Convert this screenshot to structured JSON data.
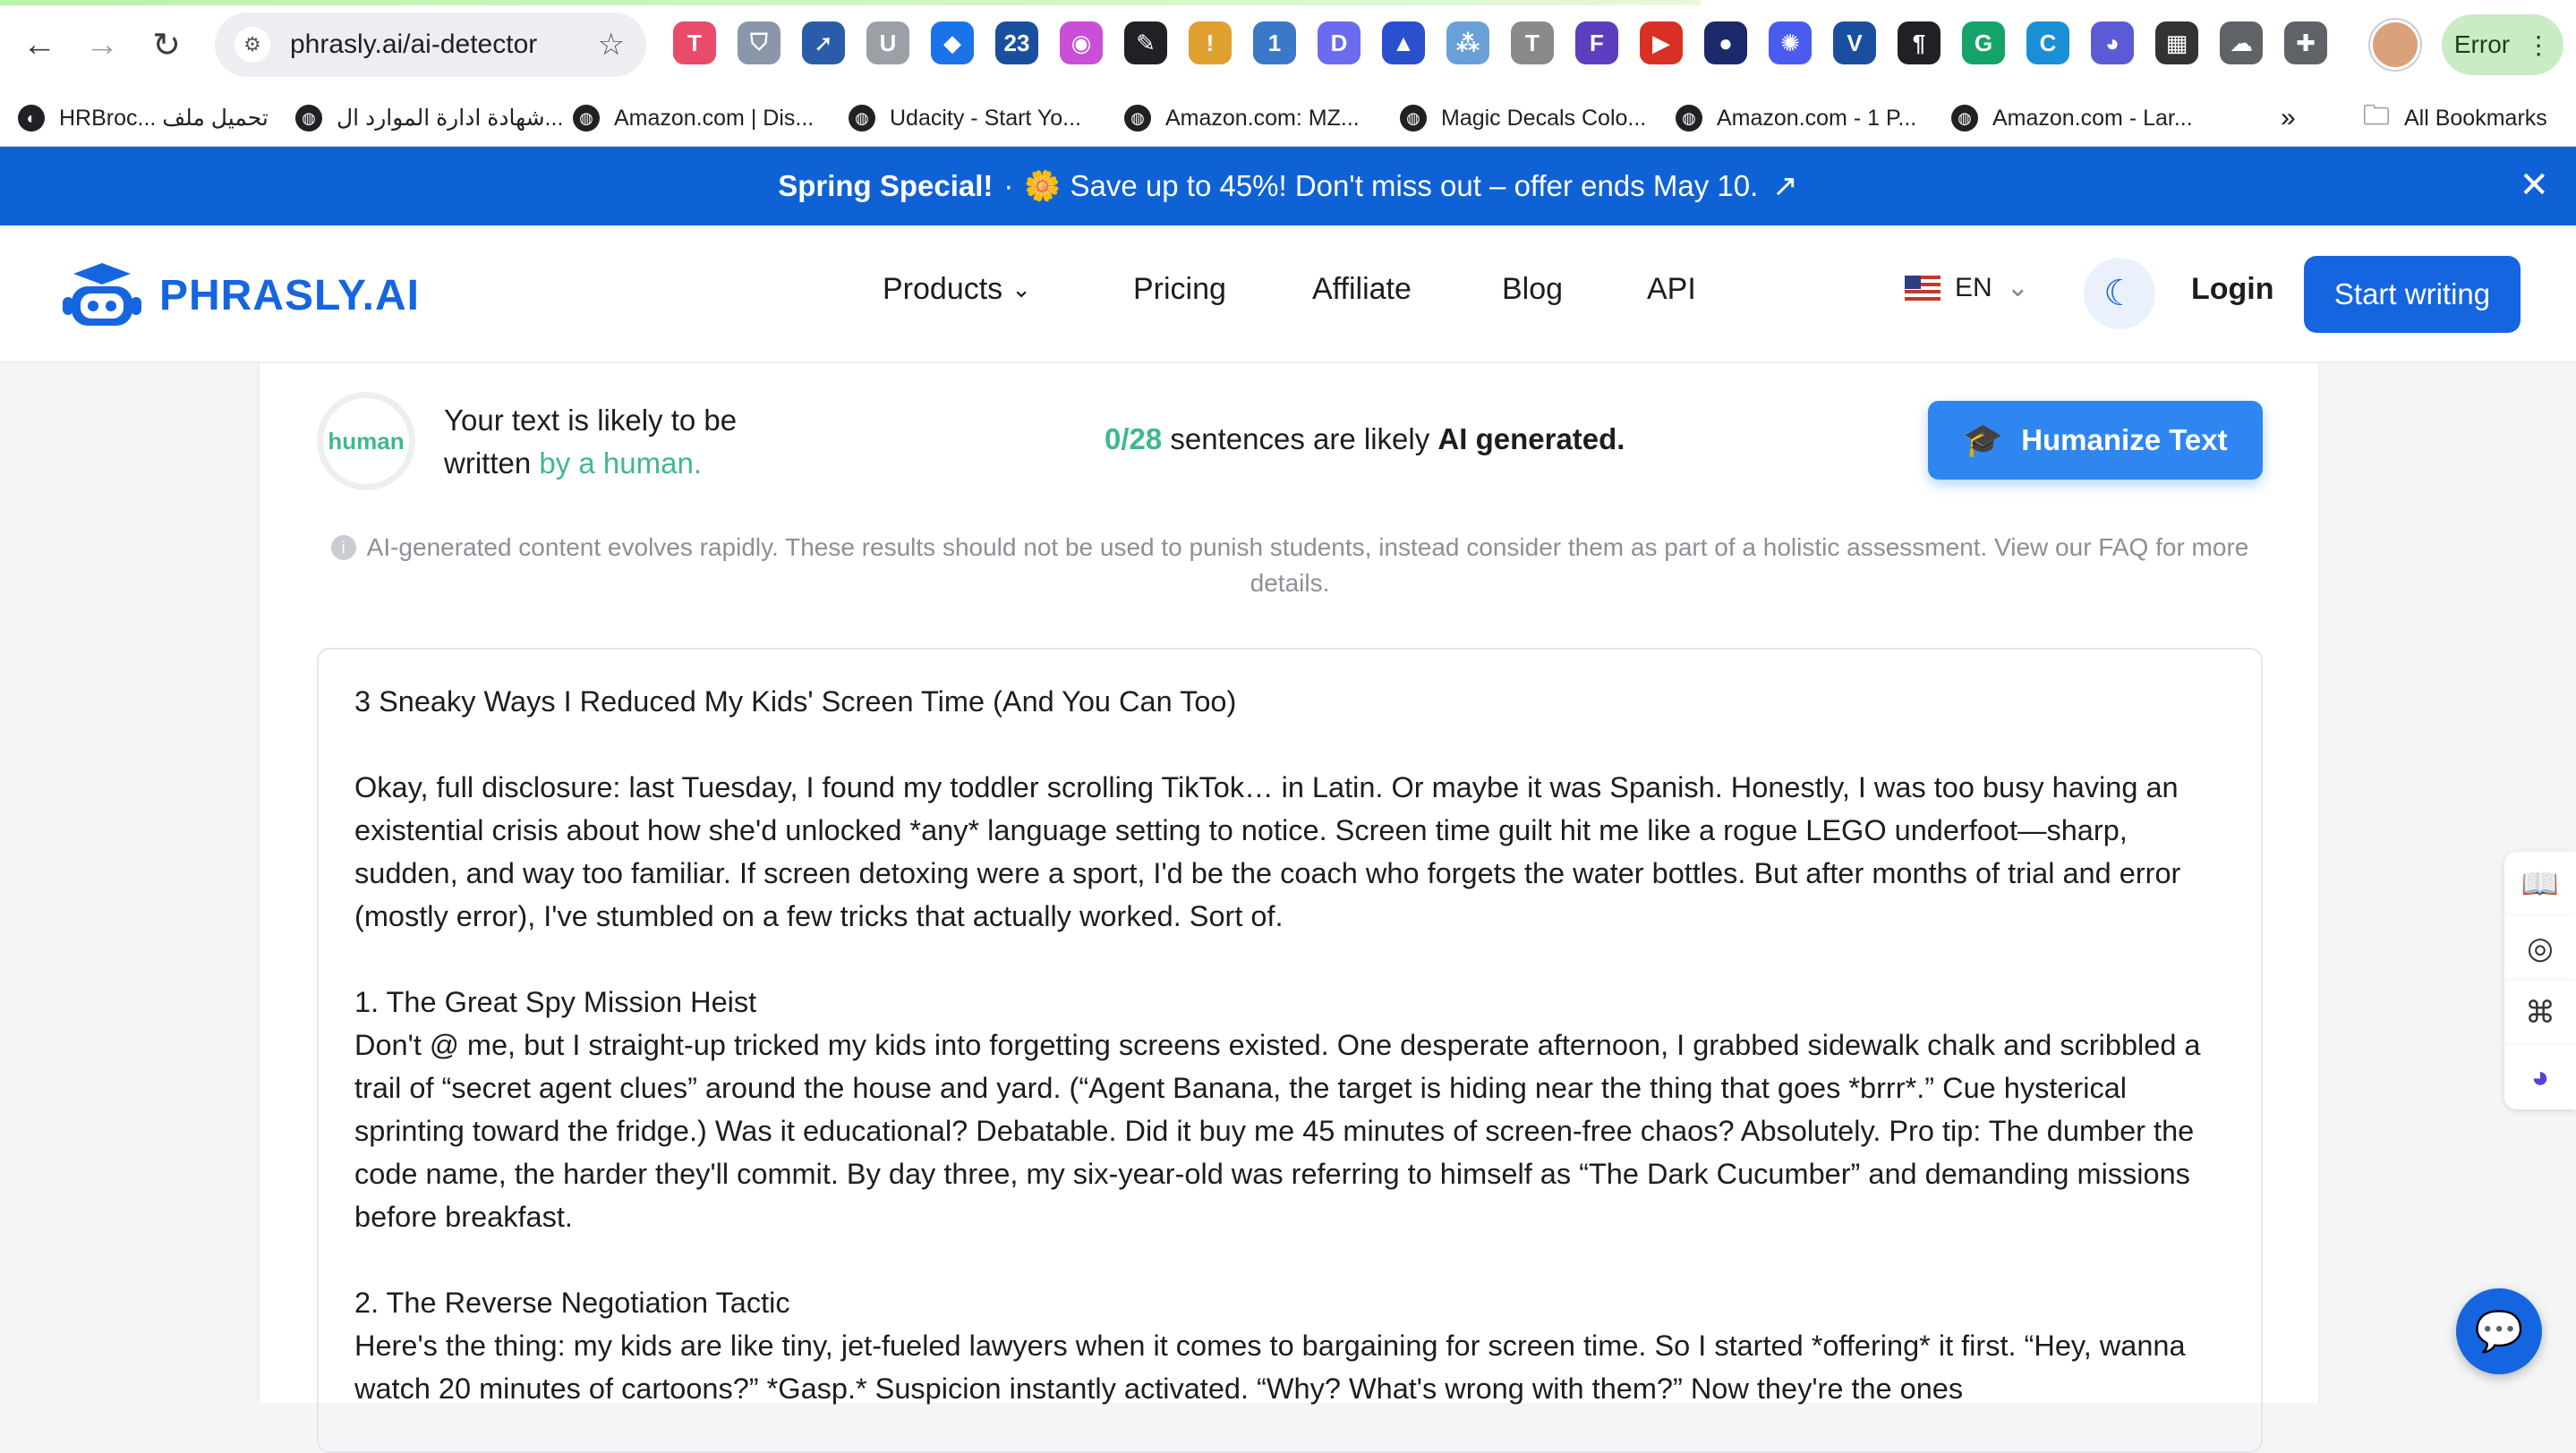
{
  "browser": {
    "url": "phrasly.ai/ai-detector",
    "profile_chip": "Error",
    "extensions": [
      {
        "icon": "extension-t-icon",
        "color": "#e94b6a",
        "glyph": "T"
      },
      {
        "icon": "extension-shield-icon",
        "color": "#8a97a8",
        "glyph": "⛉"
      },
      {
        "icon": "extension-plane-icon",
        "color": "#2a5caa",
        "glyph": "➚"
      },
      {
        "icon": "extension-u-icon",
        "color": "#9aa0a6",
        "glyph": "U"
      },
      {
        "icon": "extension-tag-icon",
        "color": "#1a73e8",
        "glyph": "◆"
      },
      {
        "icon": "extension-calendar-icon",
        "color": "#1a4fa0",
        "glyph": "23"
      },
      {
        "icon": "extension-puzzle-color-icon",
        "color": "#c94fd6",
        "glyph": "◉"
      },
      {
        "icon": "extension-eyedropper-icon",
        "color": "#202124",
        "glyph": "✎"
      },
      {
        "icon": "extension-chrome-badge-icon",
        "color": "#e0a030",
        "glyph": "!"
      },
      {
        "icon": "extension-code-icon",
        "color": "#3c78c8",
        "glyph": "1"
      },
      {
        "icon": "extension-d-icon",
        "color": "#6b6bf0",
        "glyph": "D"
      },
      {
        "icon": "extension-triangle-icon",
        "color": "#2a4fcf",
        "glyph": "▲"
      },
      {
        "icon": "extension-dots-icon",
        "color": "#6aa0d8",
        "glyph": "⁂"
      },
      {
        "icon": "extension-typewriter-icon",
        "color": "#8a8a8a",
        "glyph": "T"
      },
      {
        "icon": "extension-form-icon",
        "color": "#5b3fc0",
        "glyph": "F"
      },
      {
        "icon": "extension-play-icon",
        "color": "#d93025",
        "glyph": "▶"
      },
      {
        "icon": "extension-alien-icon",
        "color": "#1a2a6b",
        "glyph": "●"
      },
      {
        "icon": "extension-sparkle-icon",
        "color": "#4a5cf0",
        "glyph": "✺"
      },
      {
        "icon": "extension-v-icon",
        "color": "#1a4fa0",
        "glyph": "V"
      },
      {
        "icon": "extension-pilcrow-icon",
        "color": "#202124",
        "glyph": "¶"
      },
      {
        "icon": "extension-grammarly-icon",
        "color": "#15a36a",
        "glyph": "G"
      },
      {
        "icon": "extension-c-icon",
        "color": "#1a8fd6",
        "glyph": "C"
      },
      {
        "icon": "extension-robot-icon",
        "color": "#5b5bd6",
        "glyph": "◕"
      },
      {
        "icon": "extension-grid-icon",
        "color": "#333333",
        "glyph": "▦"
      },
      {
        "icon": "extension-cloud-icon",
        "color": "#5f6368",
        "glyph": "☁"
      },
      {
        "icon": "extensions-puzzle-icon",
        "color": "#5f6368",
        "glyph": "✚"
      }
    ],
    "bookmarks": [
      {
        "label": "HRBroc... تحميل ملف"
      },
      {
        "label": "شهادة ادارة الموارد ال..."
      },
      {
        "label": "Amazon.com | Dis..."
      },
      {
        "label": "Udacity - Start Yo..."
      },
      {
        "label": "Amazon.com: MZ..."
      },
      {
        "label": "Magic Decals Colo..."
      },
      {
        "label": "Amazon.com - 1 P..."
      },
      {
        "label": "Amazon.com - Lar..."
      }
    ],
    "bookmarks_overflow": "»",
    "all_bookmarks": "All Bookmarks"
  },
  "promo": {
    "title": "Spring Special!",
    "separator": "·",
    "emoji": "🌼",
    "message": "Save up to 45%! Don't miss out – offer ends May 10."
  },
  "header": {
    "logo_text": "PHRASLY.AI",
    "nav": {
      "products": "Products",
      "pricing": "Pricing",
      "affiliate": "Affiliate",
      "blog": "Blog",
      "api": "API"
    },
    "language": "EN",
    "login": "Login",
    "cta": "Start writing"
  },
  "result": {
    "gauge_label": "human",
    "verdict_line1": "Your text is likely to be",
    "verdict_prefix": "written",
    "verdict_highlight": "by a human.",
    "count": "0/28",
    "count_suffix": "sentences are likely",
    "ai_generated": "AI generated.",
    "humanize_button": "Humanize Text",
    "disclaimer": "AI-generated content evolves rapidly. These results should not be used to punish students, instead consider them as part of a holistic assessment. View our FAQ for more details."
  },
  "document": {
    "paragraphs": [
      "3 Sneaky Ways I Reduced My Kids' Screen Time (And You Can Too)",
      "Okay, full disclosure: last Tuesday, I found my toddler scrolling TikTok… in Latin. Or maybe it was Spanish. Honestly, I was too busy having an existential crisis about how she'd unlocked *any* language setting to notice. Screen time guilt hit me like a rogue LEGO underfoot—sharp, sudden, and way too familiar. If screen detoxing were a sport, I'd be the coach who forgets the water bottles. But after months of trial and error (mostly error), I've stumbled on a few tricks that actually worked. Sort of.",
      "1. The Great Spy Mission Heist\nDon't @ me, but I straight-up tricked my kids into forgetting screens existed. One desperate afternoon, I grabbed sidewalk chalk and scribbled a trail of “secret agent clues” around the house and yard. (“Agent Banana, the target is hiding near the thing that goes *brrr*.” Cue hysterical sprinting toward the fridge.) Was it educational? Debatable. Did it buy me 45 minutes of screen-free chaos? Absolutely. Pro tip: The dumber the code name, the harder they'll commit. By day three, my six-year-old was referring to himself as “The Dark Cucumber” and demanding missions before breakfast.",
      "2. The Reverse Negotiation Tactic\nHere's the thing: my kids are like tiny, jet-fueled lawyers when it comes to bargaining for screen time. So I started *offering* it first. “Hey, wanna watch 20 minutes of cartoons?” *Gasp.* Suspicion instantly activated. “Why? What's wrong with them?” Now they're the ones"
    ]
  },
  "side_rail": [
    {
      "icon": "book-icon"
    },
    {
      "icon": "podcast-icon"
    },
    {
      "icon": "apps-grid-icon"
    },
    {
      "icon": "robot-assistant-icon"
    }
  ],
  "colors": {
    "brand_blue": "#1565e0",
    "human_green": "#3fb98b",
    "humanize_blue": "#2f86f0"
  }
}
